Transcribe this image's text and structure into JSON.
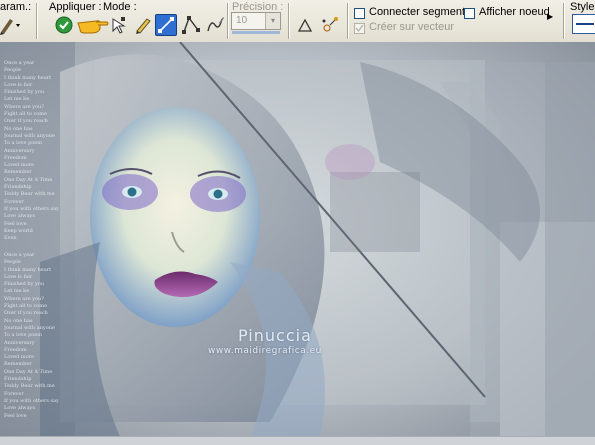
{
  "toolbar": {
    "param_label": "aram.:",
    "apply_label": "Appliquer :",
    "mode_label": "Mode :",
    "precision_label": "Précision :",
    "precision_value": "10",
    "connect_segments_label": "Connecter segments",
    "show_node_label": "Afficher noeud",
    "create_on_vector_label": "Créer sur vecteur",
    "style_label": "Style",
    "icons": [
      "brush-dropdown-icon",
      "apply-checkmark-icon",
      "pointing-hand-icon",
      "edit-nodes-icon",
      "pen-icon",
      "line-mode-icon",
      "point-to-point-icon",
      "freehand-icon",
      "knife-icon",
      "vector-nodes-icon"
    ],
    "accent_color": "#2f6fd1"
  },
  "canvas": {
    "poem_lines": [
      "Once a year",
      "People",
      "I think many heart",
      "Love is fair",
      "Finished by you",
      "Let me be",
      "Where are you?",
      "Fight all to come",
      "Over if you reach",
      "No one has",
      "Journal with anyone",
      "To a love poem",
      "Anniversary",
      "Freedom",
      "Loved more",
      "Remember",
      "One Day At A Time",
      "Friendship",
      "Teddy Bear with me",
      "Forever",
      "If you with others say",
      "Love always",
      "Feel love",
      "Keep world",
      "Even"
    ],
    "watermark_name": "Pinuccia",
    "watermark_url": "www.maidiregrafica.eu"
  }
}
